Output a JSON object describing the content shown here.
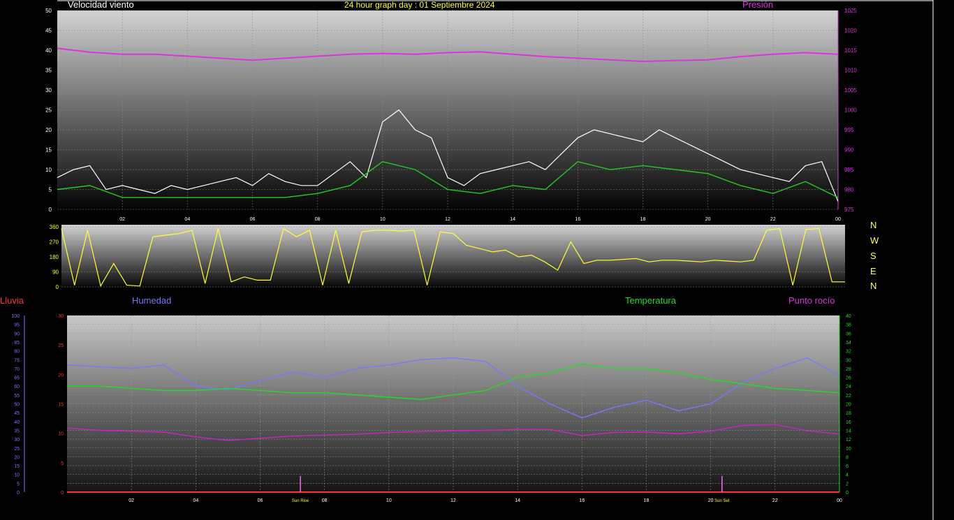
{
  "header": {
    "wind_title": "Velocidad viento",
    "main_title": "24 hour graph day : 01 Septiembre 2024",
    "pressure_title": "Presión"
  },
  "lower_titles": {
    "rain": "Lluvia",
    "humidity": "Humedad",
    "temperature": "Temperatura",
    "dewpoint": "Punto rocío"
  },
  "compass": [
    "N",
    "W",
    "S",
    "E",
    "N"
  ],
  "markers": {
    "sunrise": "Sun Rise",
    "sunset": "Sun Set"
  },
  "colors": {
    "wind_gust": "#ffffff",
    "wind_avg": "#22cc22",
    "pressure": "#dd33dd",
    "direction": "#ffff33",
    "humidity": "#7777ff",
    "temperature": "#22dd22",
    "dewpoint": "#cc22cc",
    "rain": "#ff3333"
  },
  "chart_data": [
    {
      "type": "line",
      "name": "wind-pressure",
      "x_ticks": [
        "02",
        "04",
        "06",
        "08",
        "10",
        "12",
        "14",
        "16",
        "18",
        "20",
        "22",
        "00"
      ],
      "y_left_ticks": [
        0,
        5,
        10,
        15,
        20,
        25,
        30,
        35,
        40,
        45,
        50
      ],
      "y_left_range": [
        0,
        50
      ],
      "y_right_ticks": [
        975,
        980,
        985,
        990,
        995,
        1000,
        1005,
        1010,
        1015,
        1020,
        1025
      ],
      "y_right_range": [
        975,
        1025
      ],
      "x_range_hours": [
        0,
        24
      ],
      "series": [
        {
          "key": "gust",
          "x": [
            0,
            0.5,
            1,
            1.5,
            2,
            2.5,
            3,
            3.5,
            4,
            4.5,
            5,
            5.5,
            6,
            6.5,
            7,
            7.5,
            8,
            8.5,
            9,
            9.5,
            10,
            10.5,
            11,
            11.5,
            12,
            12.5,
            13,
            13.5,
            14,
            14.5,
            15,
            15.5,
            16,
            16.5,
            17,
            17.5,
            18,
            18.5,
            19,
            19.5,
            20,
            20.5,
            21,
            21.5,
            22,
            22.5,
            23,
            23.5,
            24
          ],
          "y": [
            8,
            10,
            11,
            5,
            6,
            5,
            4,
            6,
            5,
            6,
            7,
            8,
            6,
            9,
            7,
            6,
            6,
            9,
            12,
            8,
            22,
            25,
            20,
            18,
            8,
            6,
            9,
            10,
            11,
            12,
            10,
            14,
            18,
            20,
            19,
            18,
            17,
            20,
            18,
            16,
            14,
            12,
            10,
            9,
            8,
            7,
            11,
            12,
            2
          ]
        },
        {
          "key": "avg",
          "x": [
            0,
            1,
            2,
            3,
            4,
            5,
            6,
            7,
            8,
            9,
            10,
            11,
            12,
            13,
            14,
            15,
            16,
            17,
            18,
            19,
            20,
            21,
            22,
            23,
            24
          ],
          "y": [
            5,
            6,
            3,
            3,
            3,
            3,
            3,
            3,
            4,
            6,
            12,
            10,
            5,
            4,
            6,
            5,
            12,
            10,
            11,
            10,
            9,
            6,
            4,
            7,
            3
          ]
        },
        {
          "key": "pressure",
          "x": [
            0,
            1,
            2,
            3,
            4,
            5,
            6,
            7,
            8,
            9,
            10,
            11,
            12,
            13,
            14,
            15,
            16,
            17,
            18,
            19,
            20,
            21,
            22,
            23,
            24
          ],
          "y": [
            1015.5,
            1014.5,
            1014,
            1014,
            1013.5,
            1013,
            1012.5,
            1013,
            1013.5,
            1014,
            1014.2,
            1014,
            1014.4,
            1014.6,
            1014,
            1013.4,
            1013,
            1012.6,
            1012.2,
            1012.4,
            1012.6,
            1013.4,
            1014,
            1014.4,
            1014
          ]
        }
      ]
    },
    {
      "type": "line",
      "name": "wind-direction",
      "y_ticks": [
        0,
        90,
        180,
        270,
        360
      ],
      "y_range": [
        0,
        360
      ],
      "series": [
        {
          "key": "direction",
          "x": [
            0,
            0.4,
            0.8,
            1.2,
            1.6,
            2,
            2.4,
            2.8,
            3.2,
            3.6,
            4,
            4.4,
            4.8,
            5.2,
            5.6,
            6,
            6.4,
            6.8,
            7.2,
            7.6,
            8,
            8.4,
            8.8,
            9.2,
            9.6,
            10,
            10.4,
            10.8,
            11.2,
            11.6,
            12,
            12.4,
            12.8,
            13.2,
            13.6,
            14,
            14.4,
            14.8,
            15.2,
            15.6,
            16,
            16.4,
            16.8,
            17.2,
            17.6,
            18,
            18.4,
            18.8,
            19.2,
            19.6,
            20,
            20.4,
            20.8,
            21.2,
            21.6,
            22,
            22.4,
            22.8,
            23.2,
            23.6,
            24
          ],
          "y": [
            350,
            10,
            340,
            5,
            140,
            10,
            5,
            300,
            310,
            320,
            340,
            20,
            350,
            30,
            60,
            40,
            40,
            350,
            300,
            340,
            10,
            340,
            20,
            330,
            340,
            340,
            335,
            340,
            10,
            330,
            320,
            250,
            230,
            210,
            220,
            180,
            190,
            150,
            100,
            270,
            140,
            160,
            160,
            165,
            170,
            150,
            160,
            160,
            155,
            150,
            160,
            155,
            150,
            160,
            340,
            350,
            10,
            345,
            350,
            30,
            30
          ]
        }
      ]
    },
    {
      "type": "line",
      "name": "temperature-humidity",
      "x_ticks": [
        "02",
        "04",
        "06",
        "08",
        "10",
        "12",
        "14",
        "16",
        "18",
        "20",
        "22",
        "00"
      ],
      "y_rain_ticks": [
        0,
        5,
        10,
        15,
        20,
        25,
        30
      ],
      "y_rain_range": [
        0,
        30
      ],
      "y_hum_ticks": [
        0,
        5,
        10,
        15,
        20,
        25,
        30,
        35,
        40,
        45,
        50,
        55,
        60,
        65,
        70,
        75,
        80,
        85,
        90,
        95,
        100
      ],
      "y_hum_range": [
        0,
        100
      ],
      "y_temp_ticks": [
        0,
        2,
        4,
        6,
        8,
        10,
        12,
        14,
        16,
        18,
        20,
        22,
        24,
        26,
        28,
        30,
        32,
        34,
        36,
        38,
        40
      ],
      "y_temp_range": [
        0,
        40
      ],
      "series": [
        {
          "key": "humidity",
          "x": [
            0,
            1,
            2,
            3,
            4,
            5,
            6,
            7,
            8,
            9,
            10,
            11,
            12,
            13,
            14,
            15,
            16,
            17,
            18,
            19,
            20,
            21,
            22,
            23,
            24
          ],
          "y": [
            72,
            71,
            70,
            72,
            60,
            58,
            63,
            68,
            65,
            70,
            72,
            75,
            76,
            74,
            60,
            50,
            42,
            48,
            52,
            46,
            50,
            62,
            70,
            76,
            66
          ]
        },
        {
          "key": "temperature",
          "x": [
            0,
            1,
            2,
            3,
            4,
            5,
            6,
            7,
            8,
            9,
            10,
            11,
            12,
            13,
            14,
            15,
            16,
            17,
            18,
            19,
            20,
            21,
            22,
            23,
            24
          ],
          "y": [
            24,
            24,
            23.5,
            23,
            23,
            23.5,
            23,
            22.5,
            22.5,
            22,
            21.5,
            21,
            22,
            23,
            26,
            27,
            29,
            28,
            28,
            27,
            25.5,
            24.5,
            23.5,
            23,
            22.5
          ]
        },
        {
          "key": "dewpoint",
          "x": [
            0,
            1,
            2,
            3,
            4,
            5,
            6,
            7,
            8,
            9,
            10,
            11,
            12,
            13,
            14,
            15,
            16,
            17,
            18,
            19,
            20,
            21,
            22,
            23,
            24
          ],
          "y": [
            14.5,
            14,
            13.8,
            13.6,
            12.5,
            11.7,
            12.2,
            12.7,
            12.9,
            13.1,
            13.5,
            13.7,
            13.9,
            14,
            14.2,
            14.2,
            12.8,
            13.5,
            13.6,
            13.2,
            13.8,
            15.1,
            15.3,
            13.9,
            13.1
          ]
        },
        {
          "key": "rain",
          "x": [
            0,
            24
          ],
          "y": [
            0,
            0
          ]
        }
      ]
    }
  ]
}
